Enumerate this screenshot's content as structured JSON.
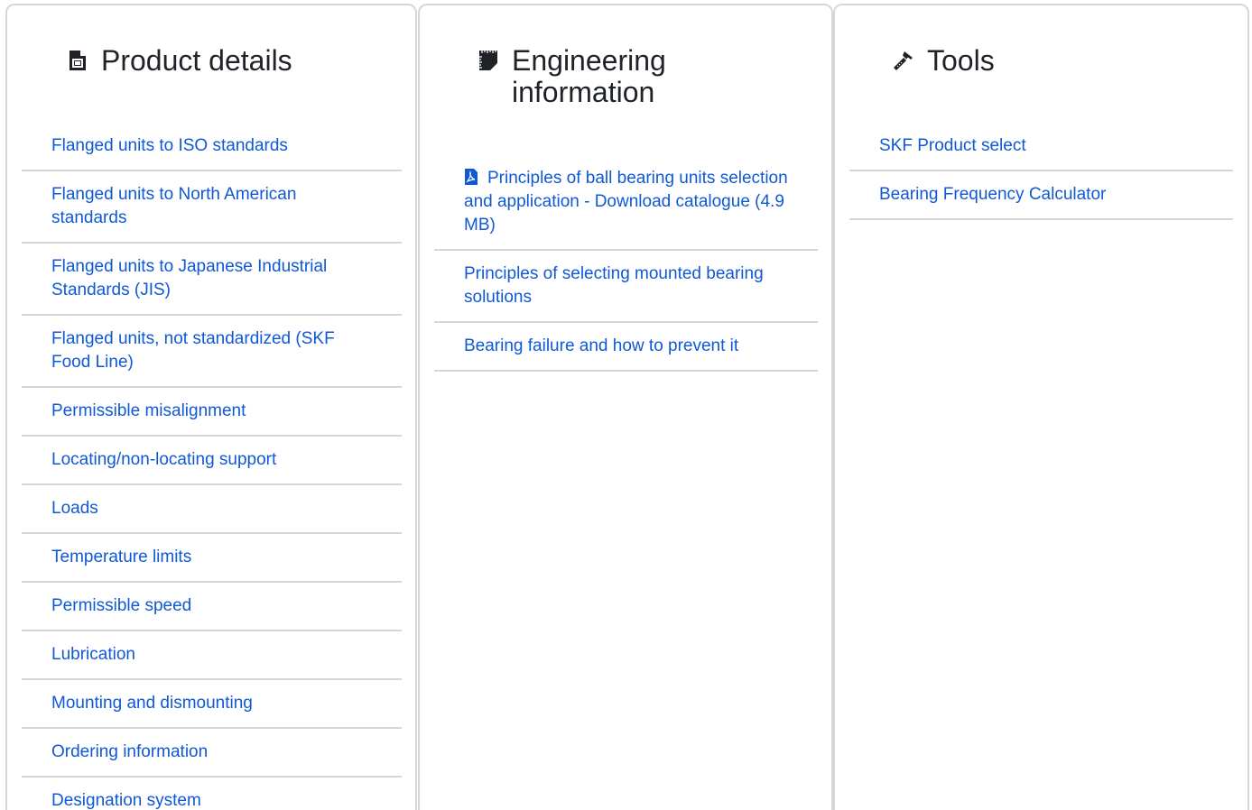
{
  "panels": {
    "product_details": {
      "title": "Product details",
      "icon": "document-icon",
      "links": [
        "Flanged units to ISO standards",
        "Flanged units to North American standards",
        "Flanged units to Japanese Industrial Standards (JIS)",
        "Flanged units, not standardized (SKF Food Line)",
        "Permissible misalignment",
        "Locating/non-locating support",
        "Loads",
        "Temperature limits",
        "Permissible speed",
        "Lubrication",
        "Mounting and dismounting",
        "Ordering information",
        "Designation system"
      ]
    },
    "engineering": {
      "title": "Engineering information",
      "icon": "ruler-book-icon",
      "links": [
        "Principles of ball bearing units selection and application - Download catalogue (4.9 MB)",
        "Principles of selecting mounted bearing solutions",
        "Bearing failure and how to prevent it"
      ]
    },
    "tools": {
      "title": "Tools",
      "icon": "hammer-icon",
      "links": [
        "SKF Product select",
        "Bearing Frequency Calculator"
      ]
    }
  },
  "colors": {
    "link": "#0f58d6",
    "border": "#d3d7dc",
    "heading": "#1f2328"
  }
}
